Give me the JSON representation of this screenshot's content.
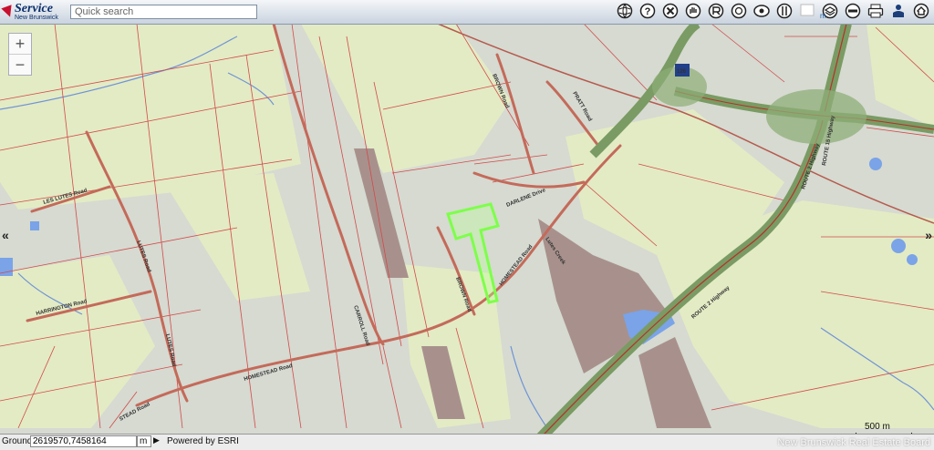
{
  "app": {
    "logo_line1": "Service",
    "logo_line2": "New Brunswick"
  },
  "search": {
    "placeholder": "Quick search"
  },
  "toolbar": {
    "icons": [
      "globe-icon",
      "help-icon",
      "clear-icon",
      "pan-icon",
      "identify-icon",
      "measure-icon",
      "overview-icon",
      "split-view-icon",
      "map-units-icon",
      "layers-icon",
      "basemap-icon",
      "print-icon",
      "profile-icon",
      "home-icon"
    ],
    "unit_label": "m"
  },
  "zoom": {
    "in": "+",
    "out": "−"
  },
  "nav": {
    "left": "«",
    "right": "»"
  },
  "roads": {
    "les_lutes": "LES LUTES Road",
    "lutes": "LUTES Road",
    "harrington": "HARRINGTON Road",
    "homestead": "HOMESTEAD Road",
    "homestead_2": "HOMESTEAD Road",
    "homestead_3": "STEAD Road",
    "carroll": "CARROLL Road",
    "brown": "BROWN Road",
    "pratt": "PRATT Road",
    "darlene": "DARLENE Drive",
    "route2_a": "ROUTE 2 Highway",
    "route2_b": "ROUTE 2 Highway",
    "route15": "ROUTE 15 Highway",
    "creek": "Lutes Creek",
    "shield": "126"
  },
  "scale": {
    "label": "500 m"
  },
  "footer": {
    "ground_label": "Ground",
    "coordinates": "2619570,7458164",
    "unit": "m",
    "go": "▶",
    "powered": "Powered by ESRI"
  },
  "watermark": "New Brunswick Real Estate Board",
  "colors": {
    "land_green": "#e4ecc6",
    "land_grey": "#d4d8d0",
    "parcel_line": "#d24a4a",
    "highway": "#7a9b63",
    "highway_line": "#b3322b",
    "water": "#6f9be6",
    "highlight": "#7dff4a",
    "crown_land": "#a9908b"
  }
}
